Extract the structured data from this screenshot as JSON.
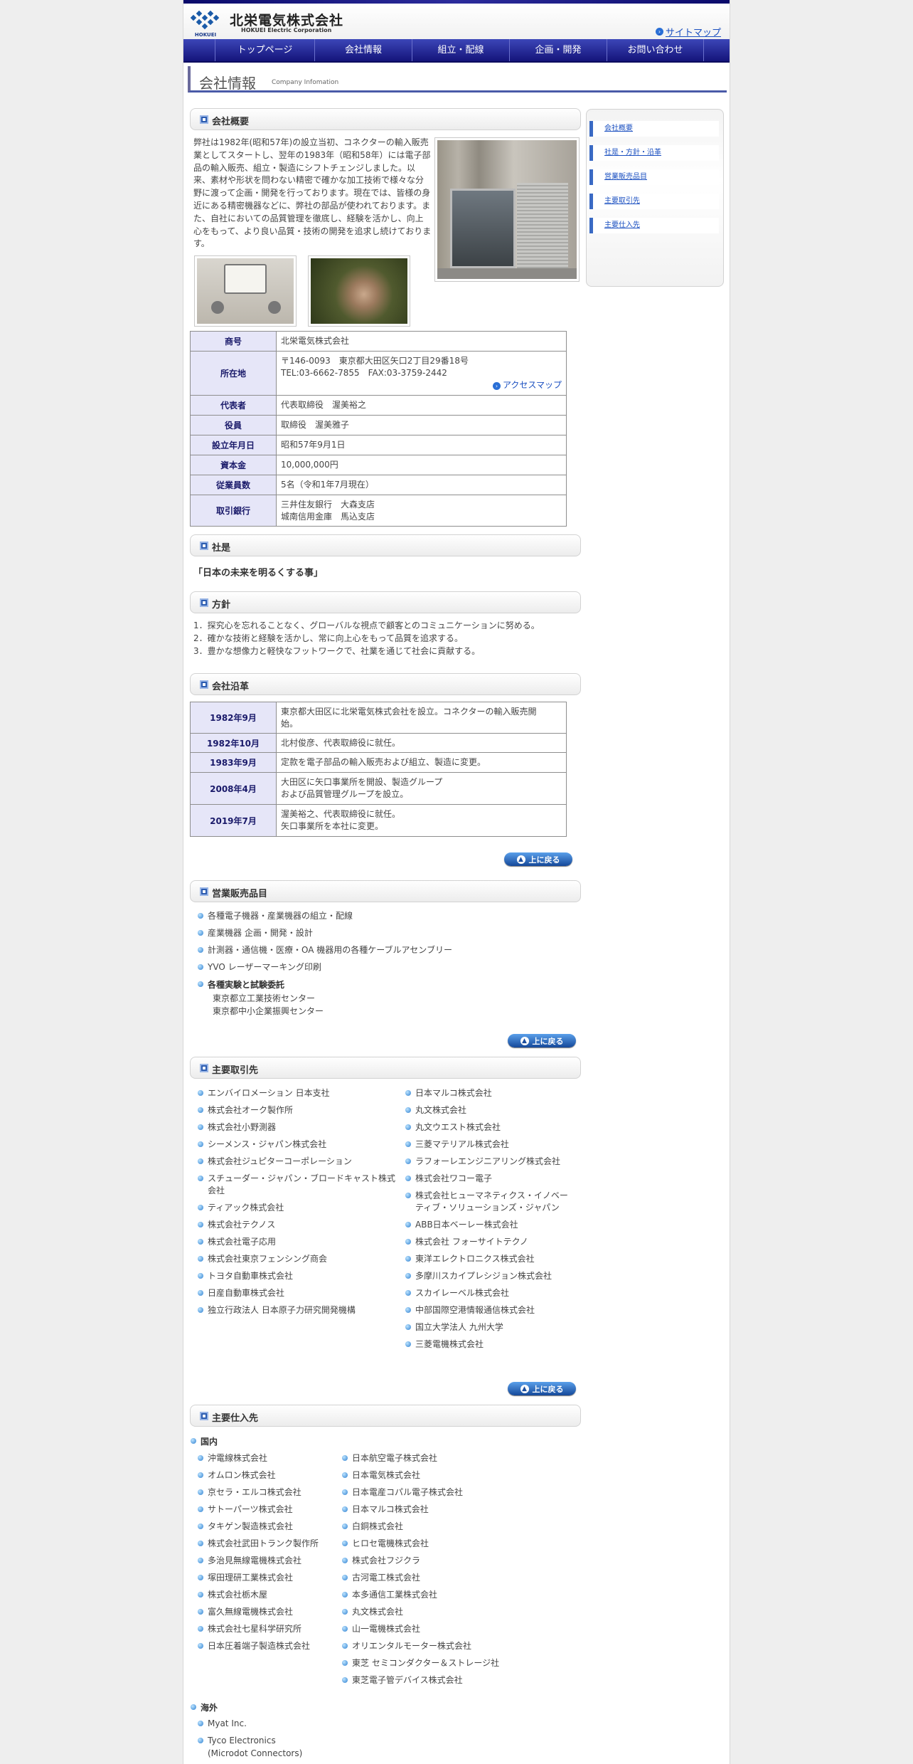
{
  "header": {
    "company_name": "北栄電気株式会社",
    "company_en": "HOKUEI Electric Corporation",
    "logo_text": "HOKUEI",
    "sitemap": "サイトマップ"
  },
  "nav": [
    "トップページ",
    "会社情報",
    "組立・配線",
    "企画・開発",
    "お問い合わせ"
  ],
  "page": {
    "title": "会社情報",
    "title_en": "Company Infomation"
  },
  "sidebar": [
    "会社概要",
    "社是・方針・沿革",
    "営業販売品目",
    "主要取引先",
    "主要仕入先"
  ],
  "overview": {
    "heading": "会社概要",
    "text": "弊社は1982年(昭和57年)の設立当初、コネクターの輸入販売業としてスタートし、翌年の1983年（昭和58年）には電子部品の輸入販売、組立・製造にシフトチェンジしました。以来、素材や形状を問わない精密で確かな加工技術で様々な分野に渡って企画・開発を行っております。現在では、皆様の身近にある精密機器などに、弊社の部品が使われております。また、自社においての品質管理を徹底し、経験を活かし、向上心をもって、より良い品質・技術の開発を追求し続けております。",
    "table": [
      {
        "label": "商号",
        "value": "北栄電気株式会社"
      },
      {
        "label": "所在地",
        "value": "〒146-0093　東京都大田区矢口2丁目29番18号",
        "value2": "TEL:03-6662-7855　FAX:03-3759-2442",
        "link": "アクセスマップ"
      },
      {
        "label": "代表者",
        "value": "代表取締役　渥美裕之"
      },
      {
        "label": "役員",
        "value": "取締役　渥美雅子"
      },
      {
        "label": "設立年月日",
        "value": "昭和57年9月1日"
      },
      {
        "label": "資本金",
        "value": "10,000,000円"
      },
      {
        "label": "従業員数",
        "value": "5名（令和1年7月現在）"
      },
      {
        "label": "取引銀行",
        "value": "三井住友銀行　大森支店",
        "value2": "城南信用金庫　馬込支店"
      }
    ]
  },
  "motto": {
    "heading": "社是",
    "text": "「日本の未来を明るくする事」"
  },
  "policy": {
    "heading": "方針",
    "items": [
      "1．探究心を忘れることなく、グローバルな視点で顧客とのコミュニケーションに努める。",
      "2．確かな技術と経験を活かし、常に向上心をもって品質を追求する。",
      "3．豊かな想像力と軽快なフットワークで、社業を通じて社会に貢献する。"
    ]
  },
  "history": {
    "heading": "会社沿革",
    "rows": [
      {
        "date": "1982年9月",
        "text": "東京都大田区に北栄電気株式会社を設立。コネクターの輸入販売開",
        "text2": "始。"
      },
      {
        "date": "1982年10月",
        "text": "北村俊彦、代表取締役に就任。"
      },
      {
        "date": "1983年9月",
        "text": "定款を電子部品の輸入販売および組立、製造に変更。"
      },
      {
        "date": "2008年4月",
        "text": "大田区に矢口事業所を開設、製造グループ",
        "text2": "および品質管理グループを設立。"
      },
      {
        "date": "2019年7月",
        "text": "渥美裕之、代表取締役に就任。",
        "text2": "矢口事業所を本社に変更。"
      }
    ]
  },
  "back_to_top": "上に戻る",
  "products": {
    "heading": "営業販売品目",
    "items": [
      "各種電子機器・産業機器の組立・配線",
      "産業機器 企画・開発・設計",
      "計測器・通信機・医療・OA 機器用の各種ケーブルアセンブリー",
      "YVO レーザーマーキング印刷"
    ],
    "sub_title": "各種実験と試験委託",
    "sub_items": [
      "東京都立工業技術センター",
      "東京都中小企業振興センター"
    ]
  },
  "customers": {
    "heading": "主要取引先",
    "left": [
      "エンバイロメーション 日本支社",
      "株式会社オーク製作所",
      "株式会社小野測器",
      "シーメンス・ジャパン株式会社",
      "株式会社ジュピターコーポレーション",
      "スチューダー・ジャパン・ブロードキャスト株式会社",
      "ティアック株式会社",
      "株式会社テクノス",
      "株式会社電子応用",
      "株式会社東京フェンシング商会",
      "トヨタ自動車株式会社",
      "日産自動車株式会社",
      "独立行政法人 日本原子力研究開発機構"
    ],
    "right": [
      "日本マルコ株式会社",
      "丸文株式会社",
      "丸文ウエスト株式会社",
      "三菱マテリアル株式会社",
      "ラフォーレエンジニアリング株式会社",
      "株式会社ワコー電子",
      "株式会社ヒューマネティクス・イノベーティブ・ソリューションズ・ジャパン",
      "ABB日本ベーレー株式会社",
      "株式会社 フォーサイトテクノ",
      "東洋エレクトロニクス株式会社",
      "多摩川スカイプレシジョン株式会社",
      "スカイレーベル株式会社",
      "中部国際空港情報通信株式会社",
      "国立大学法人 九州大学",
      "三菱電機株式会社"
    ]
  },
  "suppliers": {
    "heading": "主要仕入先",
    "domestic_label": "国内",
    "left": [
      "沖電線株式会社",
      "オムロン株式会社",
      "京セラ・エルコ株式会社",
      "サトーパーツ株式会社",
      "タキゲン製造株式会社",
      "株式会社武田トランク製作所",
      "多治見無線電機株式会社",
      "塚田理研工業株式会社",
      "株式会社栃木屋",
      "富久無線電機株式会社",
      "株式会社七星科学研究所",
      "日本圧着端子製造株式会社"
    ],
    "right": [
      "日本航空電子株式会社",
      "日本電気株式会社",
      "日本電産コパル電子株式会社",
      "日本マルコ株式会社",
      "白銅株式会社",
      "ヒロセ電機株式会社",
      "株式会社フジクラ",
      "古河電工株式会社",
      "本多通信工業株式会社",
      "丸文株式会社",
      "山一電機株式会社",
      "オリエンタルモーター株式会社",
      "東芝 セミコンダクター＆ストレージ社",
      "東芝電子管デバイス株式会社"
    ],
    "overseas_label": "海外",
    "overseas": [
      "Myat Inc.",
      "Tyco Electronics",
      "(Microdot Connectors)"
    ]
  },
  "colors": {
    "nav": "#1c1c8a",
    "accent": "#2c5cb0",
    "table_head": "#e6e6f8"
  }
}
